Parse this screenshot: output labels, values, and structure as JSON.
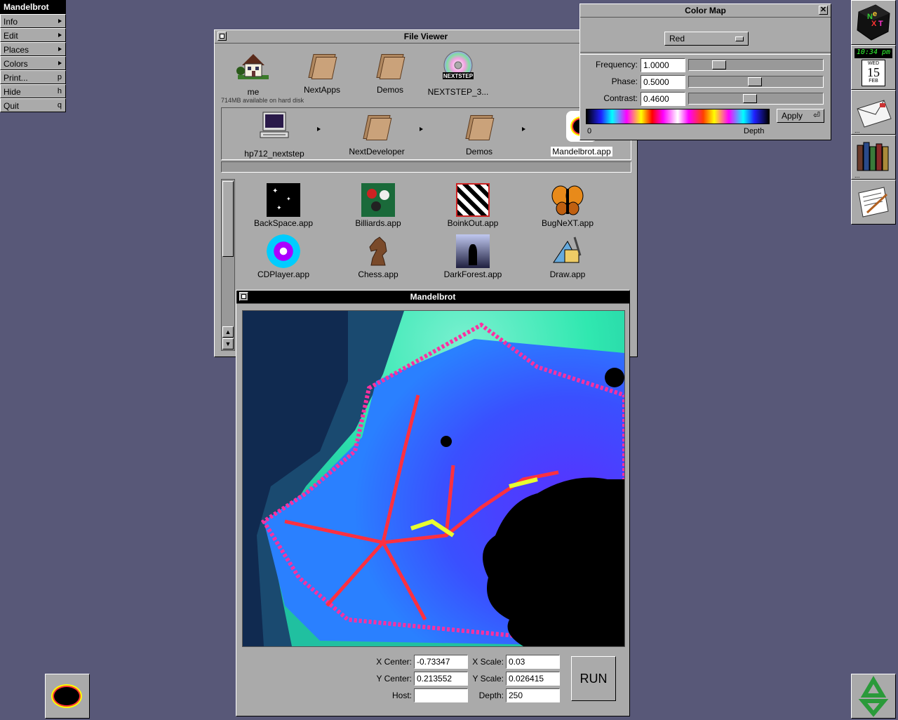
{
  "menu": {
    "title": "Mandelbrot",
    "items": [
      {
        "label": "Info",
        "key": ""
      },
      {
        "label": "Edit",
        "key": ""
      },
      {
        "label": "Places",
        "key": ""
      },
      {
        "label": "Colors",
        "key": ""
      },
      {
        "label": "Print...",
        "key": "p"
      },
      {
        "label": "Hide",
        "key": "h"
      },
      {
        "label": "Quit",
        "key": "q"
      }
    ]
  },
  "file_viewer": {
    "title": "File Viewer",
    "shelf": [
      {
        "label": "me",
        "icon": "home-icon"
      },
      {
        "label": "NextApps",
        "icon": "folder-icon"
      },
      {
        "label": "Demos",
        "icon": "folder-icon"
      },
      {
        "label": "NEXTSTEP_3...",
        "icon": "cd-icon"
      }
    ],
    "disk_status": "714MB available on hard disk",
    "browser_path": [
      {
        "label": "hp712_nextstep",
        "icon": "computer-icon"
      },
      {
        "label": "NextDeveloper",
        "icon": "folder-icon"
      },
      {
        "label": "Demos",
        "icon": "folder-icon"
      },
      {
        "label": "Mandelbrot.app",
        "icon": "mandelbrot-app-icon"
      }
    ],
    "apps": [
      {
        "label": "BackSpace.app",
        "icon": "backspace-icon"
      },
      {
        "label": "Billiards.app",
        "icon": "billiards-icon"
      },
      {
        "label": "BoinkOut.app",
        "icon": "boinkout-icon"
      },
      {
        "label": "BugNeXT.app",
        "icon": "butterfly-icon"
      },
      {
        "label": "CDPlayer.app",
        "icon": "cdplayer-icon"
      },
      {
        "label": "Chess.app",
        "icon": "chess-knight-icon"
      },
      {
        "label": "DarkForest.app",
        "icon": "darkforest-icon"
      },
      {
        "label": "Draw.app",
        "icon": "draw-icon"
      }
    ]
  },
  "color_map": {
    "title": "Color Map",
    "channel": "Red",
    "frequency_label": "Frequency:",
    "frequency_value": "1.0000",
    "phase_label": "Phase:",
    "phase_value": "0.5000",
    "contrast_label": "Contrast:",
    "contrast_value": "0.4600",
    "apply_label": "Apply",
    "scale_min": "0",
    "scale_label": "Depth"
  },
  "mandelbrot": {
    "title": "Mandelbrot",
    "x_center_label": "X Center:",
    "x_center": "-0.73347",
    "y_center_label": "Y Center:",
    "y_center": "0.213552",
    "host_label": "Host:",
    "host": "",
    "x_scale_label": "X Scale:",
    "x_scale": "0.03",
    "y_scale_label": "Y Scale:",
    "y_scale": "0.026415",
    "depth_label": "Depth:",
    "depth": "250",
    "run_label": "RUN"
  },
  "dock": {
    "clock_time": "10:34 pm",
    "clock_day": "WED",
    "clock_date": "15",
    "clock_month": "FEB"
  }
}
